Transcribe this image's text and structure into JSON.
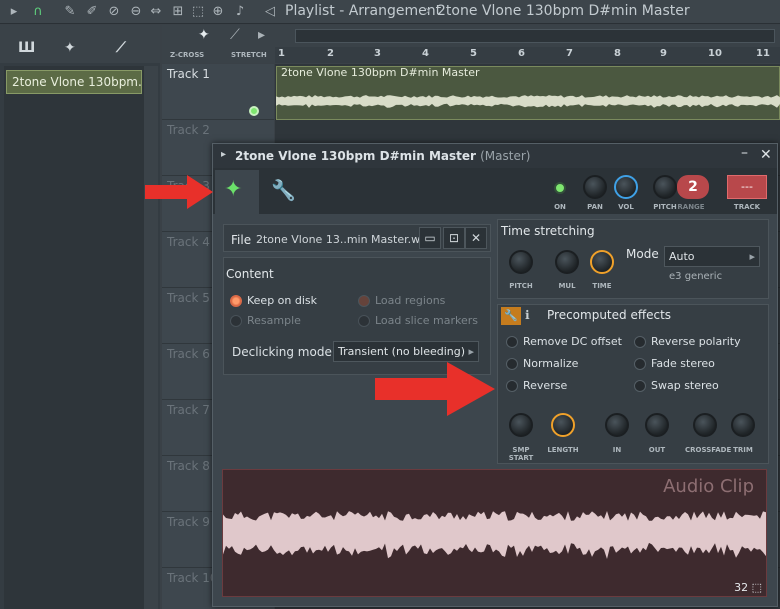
{
  "topbar": {
    "title": "Playlist - Arrangement",
    "separator": "›",
    "master": "2tone Vlone 130bpm D#min Master"
  },
  "left_panel": {
    "clip_name": "2tone Vlone 130bpm..."
  },
  "playlist": {
    "zcross": "Z-CROSS",
    "stretch": "STRETCH",
    "ruler": [
      "1",
      "2",
      "3",
      "4",
      "5",
      "6",
      "7",
      "8",
      "9",
      "10",
      "11"
    ],
    "tracks": [
      "Track 1",
      "Track 2",
      "Track 3",
      "Track 4",
      "Track 5",
      "Track 6",
      "Track 7",
      "Track 8",
      "Track 9",
      "Track 10"
    ],
    "clip_title": "2tone Vlone 130bpm D#min Master"
  },
  "window": {
    "title": "2tone Vlone 130bpm D#min Master",
    "title_sub": "(Master)",
    "knobs": {
      "on": "ON",
      "pan": "PAN",
      "vol": "VOL",
      "pitch": "PITCH",
      "range": "RANGE",
      "range_value": "2",
      "track": "TRACK",
      "track_value": "---"
    },
    "file": {
      "label": "File",
      "name": "2tone Vlone 13..min Master.wav"
    },
    "content": {
      "title": "Content",
      "keep_on_disk": "Keep on disk",
      "resample": "Resample",
      "load_regions": "Load regions",
      "load_slice_markers": "Load slice markers",
      "declicking_label": "Declicking mode",
      "declicking_value": "Transient (no bleeding)"
    },
    "time_stretching": {
      "title": "Time stretching",
      "pitch": "PITCH",
      "mul": "MUL",
      "time": "TIME",
      "mode_label": "Mode",
      "mode_value": "Auto",
      "mode_sub": "e3 generic"
    },
    "precomputed": {
      "title": "Precomputed effects",
      "remove_dc": "Remove DC offset",
      "normalize": "Normalize",
      "reverse": "Reverse",
      "reverse_polarity": "Reverse polarity",
      "fade_stereo": "Fade stereo",
      "swap_stereo": "Swap stereo",
      "smp_start": "SMP START",
      "length": "LENGTH",
      "in": "IN",
      "out": "OUT",
      "crossfade": "CROSSFADE",
      "trim": "TRIM"
    },
    "waveform": {
      "label": "Audio Clip",
      "zoom": "32"
    }
  },
  "colors": {
    "accent_green": "#6be06a",
    "highlight_arrow": "#e8302a",
    "radio_on": "#ff9a6a",
    "knob_blue": "#3fa1e6",
    "knob_orange": "#f0a12a"
  }
}
